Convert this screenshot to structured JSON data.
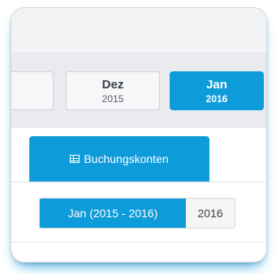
{
  "month_selector": {
    "items": [
      {
        "month": "",
        "year": ""
      },
      {
        "month": "Dez",
        "year": "2015"
      },
      {
        "month": "Jan",
        "year": "2016",
        "active": true
      }
    ]
  },
  "tabs": {
    "active_label": "Buchungskonten",
    "active_icon": "table-icon"
  },
  "period": {
    "active_label": "Jan (2015 - 2016)",
    "year_label": "2016"
  },
  "colors": {
    "accent": "#0e9bd9",
    "panel": "#e9ebee"
  }
}
